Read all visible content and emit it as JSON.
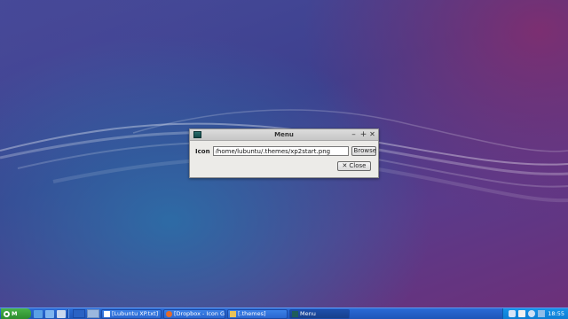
{
  "dialog": {
    "title": "Menu",
    "minimize_glyph": "–",
    "maximize_glyph": "+",
    "close_glyph": "✕",
    "icon_label": "Icon",
    "icon_path": "/home/lubuntu/.themes/xp2start.png",
    "browse_label": "Browse",
    "close_button_label": "Close"
  },
  "taskbar": {
    "start_label": "M",
    "tasks": [
      {
        "label": "[Lubuntu XP.txt]",
        "icon": "text-file-icon"
      },
      {
        "label": "[Dropbox - Icon G...",
        "icon": "browser-icon"
      },
      {
        "label": "[.themes]",
        "icon": "folder-icon"
      },
      {
        "label": "Menu",
        "icon": "window-icon",
        "active": true
      }
    ],
    "clock": "18:55"
  },
  "colors": {
    "taskbar": "#2b6bd6",
    "start": "#3a9e3b",
    "tray": "#1593e8"
  }
}
